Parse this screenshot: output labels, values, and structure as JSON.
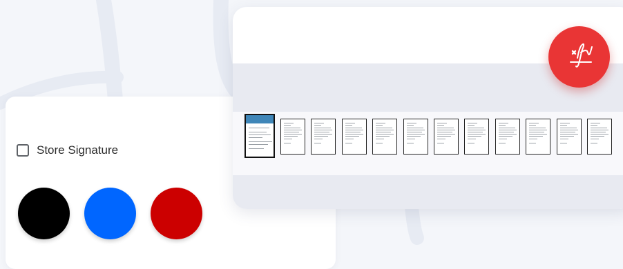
{
  "signature_options": {
    "store_signature_label": "Store Signature",
    "store_signature_checked": false,
    "ink_colors": [
      {
        "name": "black",
        "hex": "#000000"
      },
      {
        "name": "blue",
        "hex": "#0066ff"
      },
      {
        "name": "red",
        "hex": "#cc0000"
      }
    ]
  },
  "viewer": {
    "page_count": 12,
    "selected_page": 1
  },
  "fab": {
    "icon": "signature-icon",
    "color": "#e93535"
  }
}
